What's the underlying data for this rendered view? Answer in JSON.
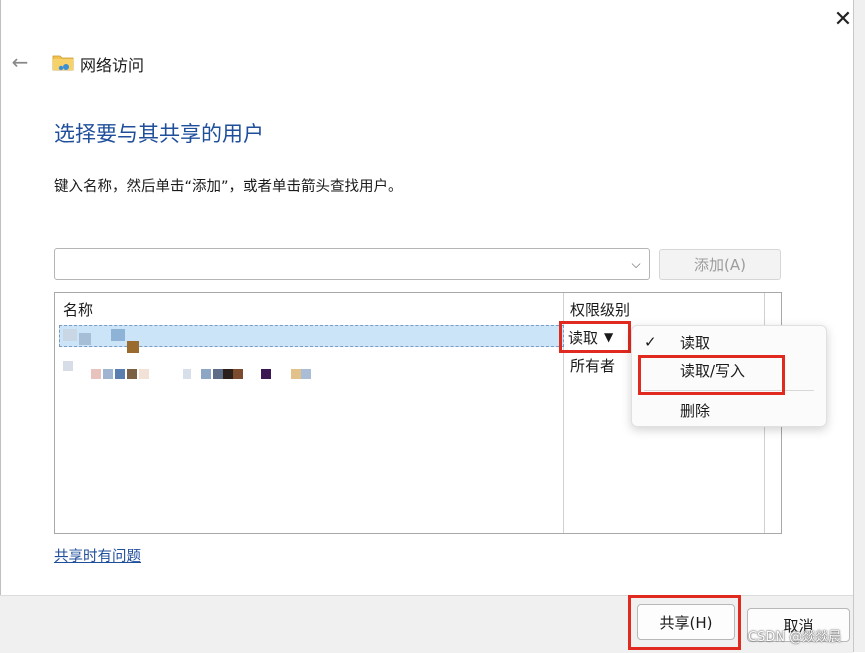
{
  "window": {
    "title": "网络访问",
    "close_glyph": "✕",
    "back_glyph": "←"
  },
  "main": {
    "heading": "选择要与其共享的用户",
    "instruction": "键入名称，然后单击“添加”，或者单击箭头查找用户。",
    "name_input_value": "",
    "name_input_placeholder": "",
    "add_button": "添加(A)"
  },
  "table": {
    "columns": [
      "名称",
      "权限级别"
    ],
    "rows": [
      {
        "name": "",
        "permission": "读取"
      },
      {
        "name": "",
        "permission": "所有者"
      }
    ]
  },
  "permission_menu": {
    "items": [
      {
        "label": "读取",
        "checked": true
      },
      {
        "label": "读取/写入",
        "checked": false
      },
      {
        "label": "删除",
        "checked": false
      }
    ],
    "check_glyph": "✓"
  },
  "link": "共享时有问题",
  "footer": {
    "share_button": "共享(H)",
    "cancel_button": "取消"
  },
  "watermark": "CSDN @燚燚晨",
  "colors": {
    "accent_blue": "#1f4e9b",
    "highlight_red": "#e02a1f",
    "selection_blue": "#cce4f7"
  }
}
